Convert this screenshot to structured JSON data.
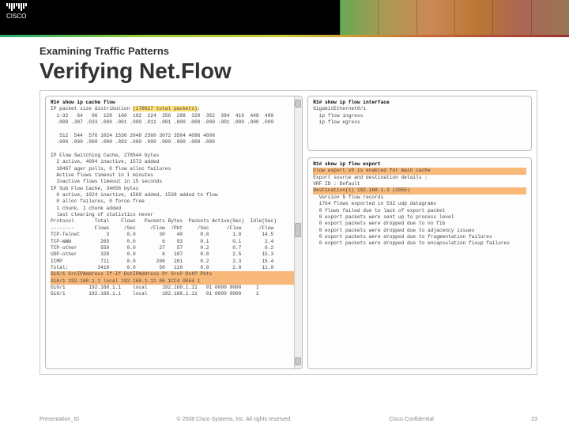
{
  "logo_text": "CISCO",
  "pretitle": "Examining Traffic Patterns",
  "title": "Verifying Net.Flow",
  "left": {
    "cmd": "R1# show ip cache flow",
    "line1a": "IP packet size distribution ",
    "line1hl": "(178617 total packets)",
    "line1b": ":",
    "block1": "  1-32   64   96  128  160  192  224  256  288  320  352  384  416  448  480\n  .000 .397 .033 .000 .001 .000 .011 .001 .000 .000 .000 .001 .000 .000 .000\n\n   512  544  576 1024 1536 2048 2560 3072 3584 4096 4608\n  .000 .000 .000 .000 .893 .000 .000 .000 .000 .000 .000\n\nIP Flow Switching Cache, 278544 bytes\n  2 active, 4094 inactive, 1573 added\n  18467 ager polls, 0 flow alloc failures\n  Active flows timeout in 1 minutes\n  Inactive flows timeout in 15 seconds\nIP Sub Flow Cache, 34056 bytes\n  0 active, 1024 inactive, 1569 added, 1538 added to flow\n  0 alloc failures, 0 force free\n  1 chunk, 1 chunk added\n  last clearing of statistics never\nProtocol       Total    Flows   Packets Bytes  Packets Active(Sec)  Idle(Sec)\n--------       Flows     /Sec     /Flow  /Pkt     /Sec      /Flow      /Flow\nTCP-Telnet         3      0.0        30    40      0.0        1.0       14.5\nTCP-WWW          265      0.0         6    93      0.1        0.1        2.4\nTCP-other        559      0.0        27    57      0.2        0.7        6.2\nUDP-other        328      0.0         6   107      0.0        2.5       15.3\nICMP             711      0.0       206   261      0.2        2.3       15.4\nTotal:          3419      0.0        50   110      0.8        2.8       11.0\n",
    "hl1": "Gi0/1        SrcIPAddress   If-If     DstIPAddress   Pr SrcP DstP  Pkts",
    "hl2": "Gi0/1        192.168.1.1    local     192.168.1.11   06 1CC4 0064     1",
    "tail": "Gi0/1        192.168.1.1    local     192.168.1.11   01 0000 0000     1\nGi0/1        192.168.1.1    local     192.168.1.11   01 0000 0000     1"
  },
  "right1": {
    "cmd": "R1# show ip flow interface",
    "body": "GigabitEthernet0/1\n  ip flow ingress\n  ip flow egress"
  },
  "right2": {
    "cmd": "R1# show ip flow export",
    "hl1": "Flow export v5 is enabled for main cache",
    "mid": "Export source and destination details :\nVRF ID : Default",
    "hl2": "  Destination(1)  192.168.1.3 (2055)",
    "tail": "  Version 5 flow records\n  1764 flows exported in 532 udp datagrams\n  0 flows failed due to lack of export packet\n  0 export packets were sent up to process level\n  0 export packets were dropped due to no fib\n  0 export packets were dropped due to adjacency issues\n  0 export packets were dropped due to fragmentation failures\n  0 export packets were dropped due to encapsulation fixup failures"
  },
  "footer": {
    "left": "Presentation_ID",
    "mid": "© 2008 Cisco Systems, Inc. All rights reserved.",
    "right1": "Cisco Confidential",
    "right2": "23"
  }
}
